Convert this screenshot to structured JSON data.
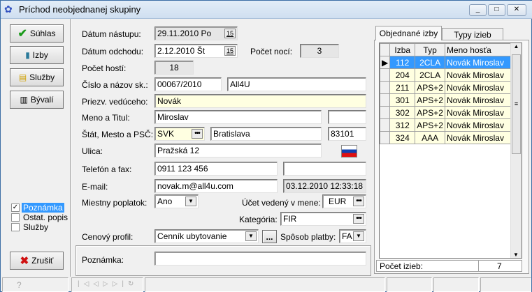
{
  "window": {
    "title": "Príchod neobjednanej skupiny",
    "minimize": "_",
    "maximize": "□",
    "close": "✕"
  },
  "left": {
    "buttons": [
      {
        "label": "Súhlas",
        "icon": "checkmark-icon"
      },
      {
        "label": "Izby",
        "icon": "door-icon"
      },
      {
        "label": "Služby",
        "icon": "services-icon"
      },
      {
        "label": "Bývalí",
        "icon": "book-icon"
      }
    ],
    "checkboxes": [
      {
        "label": "Poznámka",
        "checked": true
      },
      {
        "label": "Ostat. popis",
        "checked": false
      },
      {
        "label": "Služby",
        "checked": false
      }
    ],
    "cancel": "Zrušiť"
  },
  "form": {
    "arrival_label": "Dátum nástupu:",
    "arrival": "29.11.2010  Po",
    "departure_label": "Dátum odchodu:",
    "departure": "2.12.2010  Št",
    "calendar": "15",
    "nights_label": "Počet nocí:",
    "nights": "3",
    "guests_label": "Počet hostí:",
    "guests": "18",
    "group_label": "Číslo a názov sk.:",
    "group_no": "00067/2010",
    "group_name": "All4U",
    "leader_label": "Priezv. vedúceho:",
    "leader": "Novák",
    "name_label": "Meno a Titul:",
    "first_name": "Miroslav",
    "title": "",
    "state_label": "Štát, Mesto a PSČ:",
    "state": "SVK",
    "city": "Bratislava",
    "zip": "83101",
    "street_label": "Ulica:",
    "street": "Pražská 12",
    "phone_label": "Telefón a fax:",
    "phone": "0911 123 456",
    "fax": "",
    "email_label": "E-mail:",
    "email": "novak.m@all4u.com",
    "email_date": "03.12.2010 12:33:18",
    "fee_label": "Miestny poplatok:",
    "fee": "Ano",
    "currency_label": "Účet vedený v mene:",
    "currency": "EUR",
    "category_label": "Kategória:",
    "category": "FIR",
    "price_label": "Cenový profil:",
    "price": "Cenník ubytovanie",
    "price_more": "...",
    "payment_label": "Spôsob platby:",
    "payment": "FA",
    "note_label": "Poznámka:",
    "note": "",
    "dots": "•••"
  },
  "tabs": [
    {
      "label": "Objednané izby",
      "active": true
    },
    {
      "label": "Typy izieb",
      "active": false
    }
  ],
  "grid": {
    "columns": [
      "Izba",
      "Typ",
      "Meno hosťa"
    ],
    "rows": [
      [
        "112",
        "2CLA",
        "Novák Miroslav"
      ],
      [
        "204",
        "2CLA",
        "Novák Miroslav"
      ],
      [
        "211",
        "APS+2",
        "Novák Miroslav"
      ],
      [
        "301",
        "APS+2",
        "Novák Miroslav"
      ],
      [
        "302",
        "APS+2",
        "Novák Miroslav"
      ],
      [
        "312",
        "APS+2",
        "Novák Miroslav"
      ],
      [
        "324",
        "AAA",
        "Novák Miroslav"
      ]
    ],
    "selected_row": 0,
    "count_label": "Počet izieb:",
    "count": "7"
  },
  "colors": {
    "selection": "#3399ff",
    "row_bg": "#ffffe1",
    "yellow_field": "#ffffe1"
  }
}
